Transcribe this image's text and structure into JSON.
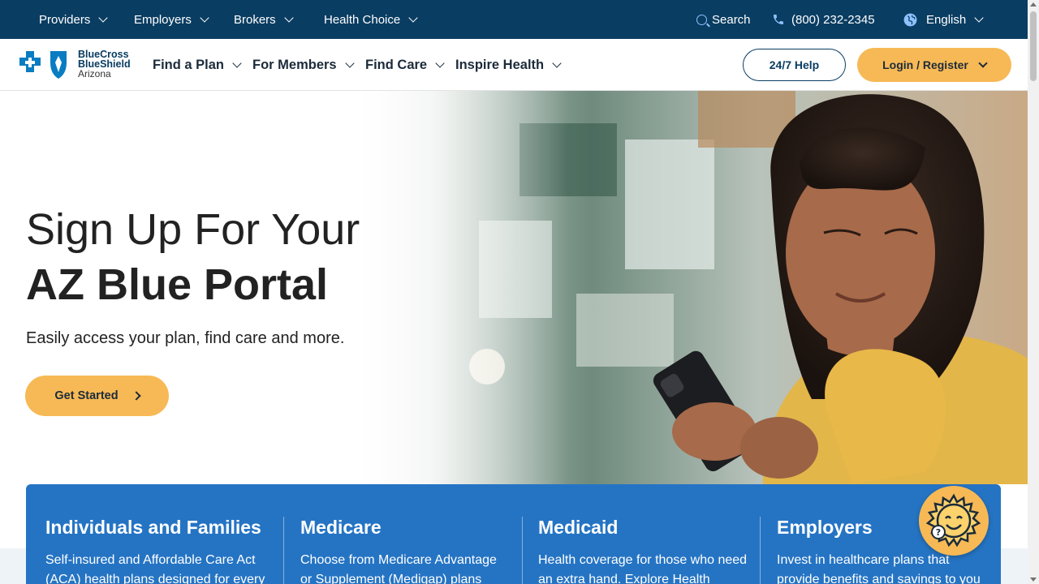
{
  "topbar": {
    "items": [
      {
        "label": "Providers"
      },
      {
        "label": "Employers"
      },
      {
        "label": "Brokers"
      },
      {
        "label": "Health Choice"
      }
    ],
    "search_label": "Search",
    "phone": "(800) 232-2345",
    "language": "English"
  },
  "brand": {
    "line1": "BlueCross",
    "line2": "BlueShield",
    "line3": "Arizona"
  },
  "nav": {
    "items": [
      {
        "label": "Find a Plan"
      },
      {
        "label": "For Members"
      },
      {
        "label": "Find Care"
      },
      {
        "label": "Inspire Health"
      }
    ],
    "help_label": "24/7 Help",
    "login_label": "Login / Register"
  },
  "hero": {
    "title_line1": "Sign Up For Your",
    "title_line2": "AZ Blue Portal",
    "subtitle": "Easily access your plan, find care and more.",
    "cta_label": "Get Started"
  },
  "cards": [
    {
      "title": "Individuals and Families",
      "text": "Self-insured and Affordable Care Act (ACA) health plans designed for every"
    },
    {
      "title": "Medicare",
      "text": "Choose from Medicare Advantage or Supplement (Medigap) plans"
    },
    {
      "title": "Medicaid",
      "text": "Health coverage for those who need an extra hand. Explore Health"
    },
    {
      "title": "Employers",
      "text": "Invest in healthcare plans that provide benefits and savings to you"
    }
  ],
  "colors": {
    "topbar": "#0a3d62",
    "accent": "#f7b955",
    "cards": "#2574c4"
  }
}
